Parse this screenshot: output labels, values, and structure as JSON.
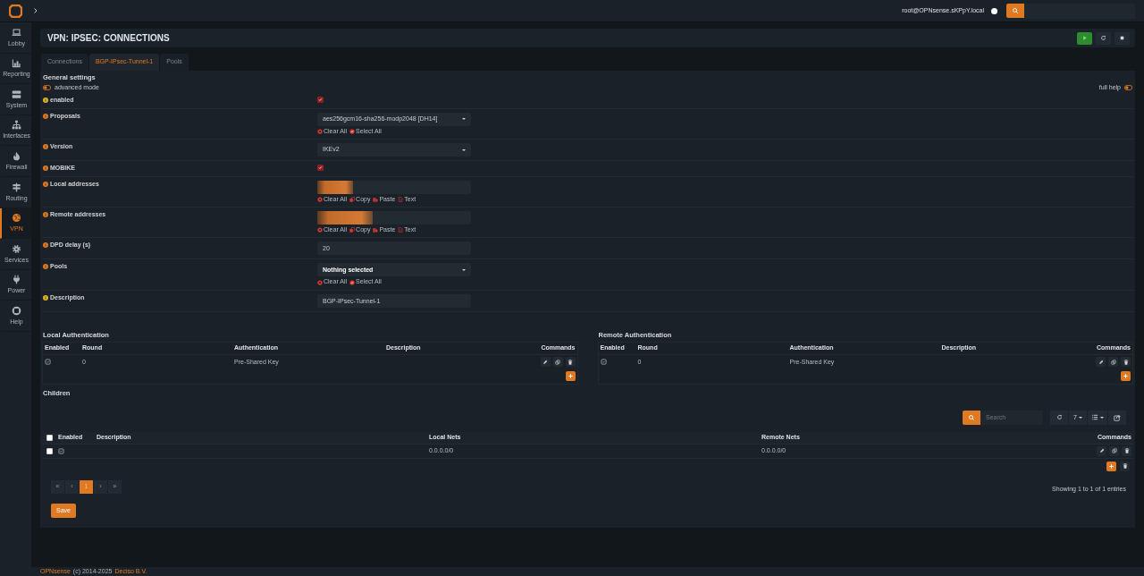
{
  "topbar": {
    "user": "root@OPNsense.sKPpY.local"
  },
  "sidebar": {
    "items": [
      {
        "label": "Lobby",
        "selected": false
      },
      {
        "label": "Reporting",
        "selected": false
      },
      {
        "label": "System",
        "selected": false
      },
      {
        "label": "Interfaces",
        "selected": false
      },
      {
        "label": "Firewall",
        "selected": false
      },
      {
        "label": "Routing",
        "selected": false
      },
      {
        "label": "VPN",
        "selected": true
      },
      {
        "label": "Services",
        "selected": false
      },
      {
        "label": "Power",
        "selected": false
      },
      {
        "label": "Help",
        "selected": false
      }
    ]
  },
  "page_title": "VPN: IPSEC: CONNECTIONS",
  "tabs": [
    {
      "label": "Connections",
      "selected": false
    },
    {
      "label": "BGP-IPsec-Tunnel-1",
      "selected": true
    },
    {
      "label": "Pools",
      "selected": false
    }
  ],
  "general": {
    "title": "General settings",
    "advanced_mode": {
      "label": "advanced mode",
      "on": false
    },
    "full_help": {
      "label": "full help",
      "on": false
    },
    "fields": [
      {
        "label": "enabled",
        "color": "#dfb526",
        "kind": "checkbox",
        "checked": true
      },
      {
        "label": "Proposals",
        "color": "#e07a22",
        "kind": "select",
        "value": "aes256gcm16-sha256-modp2048 [DH14]",
        "actions": [
          {
            "label": "Clear All",
            "kind": "clear"
          },
          {
            "label": "Select All",
            "kind": "select"
          }
        ]
      },
      {
        "label": "Version",
        "color": "#e07a22",
        "kind": "select",
        "value": "IKEv2"
      },
      {
        "label": "MOBIKE",
        "color": "#e07a22",
        "kind": "checkbox",
        "checked": true
      },
      {
        "label": "Local addresses",
        "color": "#e07a22",
        "kind": "tokens",
        "redacted": true,
        "actions": [
          {
            "label": "Clear All",
            "kind": "clear"
          },
          {
            "label": "Copy",
            "kind": "copy"
          },
          {
            "label": "Paste",
            "kind": "paste"
          },
          {
            "label": "Text",
            "kind": "text"
          }
        ]
      },
      {
        "label": "Remote addresses",
        "color": "#e07a22",
        "kind": "tokens",
        "redacted": true,
        "actions": [
          {
            "label": "Clear All",
            "kind": "clear"
          },
          {
            "label": "Copy",
            "kind": "copy"
          },
          {
            "label": "Paste",
            "kind": "paste"
          },
          {
            "label": "Text",
            "kind": "text"
          }
        ]
      },
      {
        "label": "DPD delay (s)",
        "color": "#e07a22",
        "kind": "input",
        "value": "20"
      },
      {
        "label": "Pools",
        "color": "#e07a22",
        "kind": "select",
        "placeholder": "Nothing selected",
        "actions": [
          {
            "label": "Clear All",
            "kind": "clear"
          },
          {
            "label": "Select All",
            "kind": "select"
          }
        ]
      },
      {
        "label": "Description",
        "color": "#dfb526",
        "kind": "input",
        "value": "BGP-IPsec-Tunnel-1"
      }
    ]
  },
  "auth_tables": [
    {
      "title": "Local Authentication",
      "columns": [
        "Enabled",
        "Round",
        "Authentication",
        "Description",
        "Commands"
      ],
      "rows": [
        {
          "enabled": true,
          "round": "0",
          "authentication": "Pre-Shared Key"
        }
      ]
    },
    {
      "title": "Remote Authentication",
      "columns": [
        "Enabled",
        "Round",
        "Authentication",
        "Description",
        "Commands"
      ],
      "rows": [
        {
          "enabled": true,
          "round": "0",
          "authentication": "Pre-Shared Key"
        }
      ]
    }
  ],
  "children": {
    "title": "Children",
    "select_all": {
      "checked": false
    },
    "search_placeholder": "Search",
    "page_size": "7",
    "columns": [
      "Enabled",
      "Description",
      "Local Nets",
      "Remote Nets",
      "Commands"
    ],
    "rows": [
      {
        "selected": false,
        "enabled": true,
        "local_nets": "0.0.0.0/0",
        "remote_nets": "0.0.0.0/0"
      }
    ],
    "pagination": [
      {
        "label": "«",
        "selected": false
      },
      {
        "label": "‹",
        "selected": false
      },
      {
        "label": "1",
        "selected": true
      },
      {
        "label": "›",
        "selected": false
      },
      {
        "label": "»",
        "selected": false
      }
    ],
    "info": "Showing 1 to 1 of 1 entries"
  },
  "save_button": "Save",
  "footer": {
    "brand": "OPNsense",
    "copyright": "(c) 2014-2025",
    "company": "Deciso B.V."
  }
}
